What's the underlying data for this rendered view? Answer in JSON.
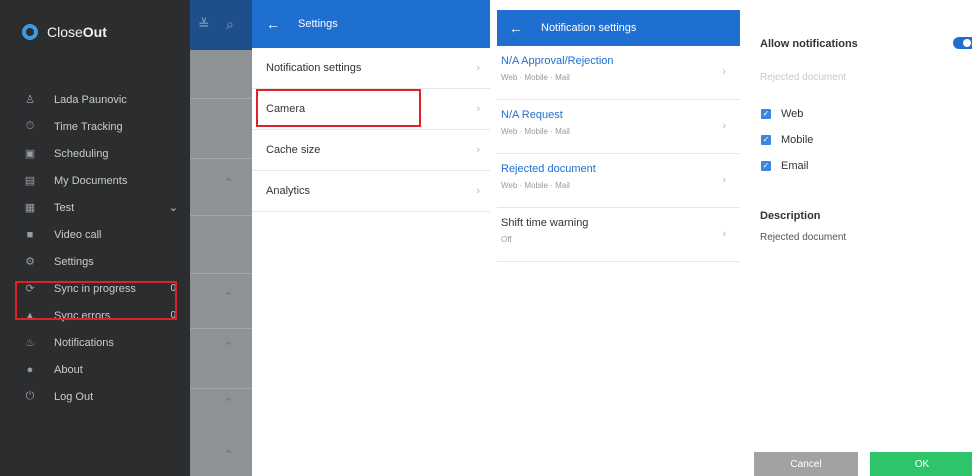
{
  "colors": {
    "drawer_bg": "#2b2d2f",
    "brand_blue": "#1f6fd1",
    "highlight_red": "#e0202b",
    "ok_green": "#2fc46a",
    "cancel_gray": "#a2a2a2"
  },
  "drawer": {
    "brand": {
      "prefix": "Close",
      "suffix": "Out",
      "icon": "closeout-logo-icon"
    },
    "items": [
      {
        "label": "Lada Paunovic",
        "icon": "user-icon"
      },
      {
        "label": "Time Tracking",
        "icon": "stopwatch-icon"
      },
      {
        "label": "Scheduling",
        "icon": "calendar-icon"
      },
      {
        "label": "My Documents",
        "icon": "documents-icon"
      },
      {
        "label": "Test",
        "icon": "form-icon"
      },
      {
        "label": "Video call",
        "icon": "video-icon"
      },
      {
        "label": "Settings",
        "icon": "gear-icon"
      },
      {
        "label": "Sync in progress",
        "icon": "sync-icon",
        "count": "0"
      },
      {
        "label": "Sync errors",
        "icon": "warning-icon",
        "count": "0"
      },
      {
        "label": "Notifications",
        "icon": "bell-icon"
      },
      {
        "label": "About",
        "icon": "info-icon"
      },
      {
        "label": "Log Out",
        "icon": "power-icon"
      }
    ]
  },
  "settings": {
    "title": "Settings",
    "rows": [
      "Notification settings",
      "Camera",
      "Cache size",
      "Analytics"
    ]
  },
  "notification_settings": {
    "title": "Notification settings",
    "rows": [
      {
        "title": "N/A Approval/Rejection",
        "subtitle": "Web · Mobile · Mail"
      },
      {
        "title": "N/A Request",
        "subtitle": "Web · Mobile · Mail"
      },
      {
        "title": "Rejected document",
        "subtitle": "Web · Mobile · Mail"
      },
      {
        "title": "Shift time warning",
        "subtitle": "Off"
      }
    ]
  },
  "detail": {
    "allow_label": "Allow notifications",
    "allow_on": true,
    "faded_title": "Rejected document",
    "checkboxes": [
      {
        "label": "Web",
        "checked": true
      },
      {
        "label": "Mobile",
        "checked": true
      },
      {
        "label": "Email",
        "checked": true
      }
    ],
    "description_heading": "Description",
    "description_value": "Rejected document",
    "cancel_label": "Cancel",
    "ok_label": "OK"
  }
}
